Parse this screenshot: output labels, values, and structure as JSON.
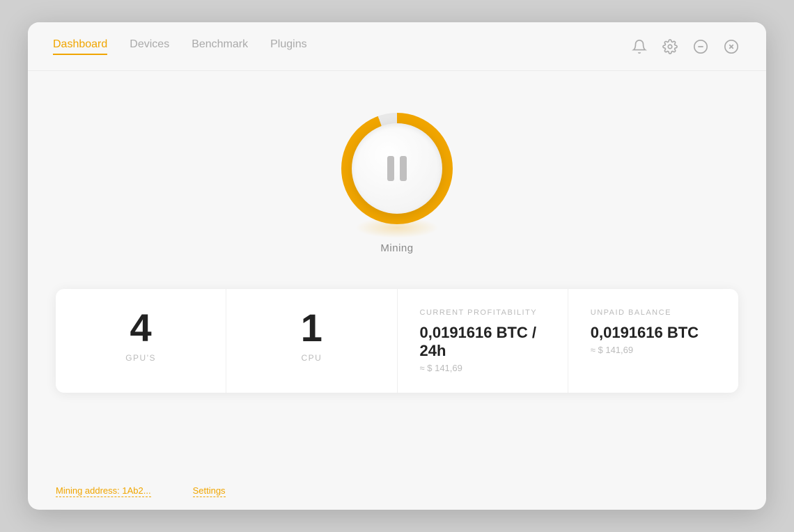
{
  "nav": {
    "items": [
      {
        "label": "Dashboard",
        "active": true
      },
      {
        "label": "Devices",
        "active": false
      },
      {
        "label": "Benchmark",
        "active": false
      },
      {
        "label": "Plugins",
        "active": false
      }
    ]
  },
  "header": {
    "icons": [
      {
        "name": "bell-icon",
        "symbol": "🔔"
      },
      {
        "name": "settings-icon",
        "symbol": "⚙"
      },
      {
        "name": "minimize-icon",
        "symbol": "⊖"
      },
      {
        "name": "close-icon",
        "symbol": "⊗"
      }
    ]
  },
  "mining": {
    "status_label": "Mining"
  },
  "stats": [
    {
      "id": "gpus",
      "number": "4",
      "sublabel": "GPU'S"
    },
    {
      "id": "cpu",
      "number": "1",
      "sublabel": "CPU"
    },
    {
      "id": "profitability",
      "label": "CURRENT PROFITABILITY",
      "value_main": "0,0191616 BTC / 24h",
      "value_sub": "≈ $ 141,69"
    },
    {
      "id": "balance",
      "label": "UNPAID BALANCE",
      "value_main": "0,0191616 BTC",
      "value_sub": "≈ $ 141,69"
    }
  ],
  "bottom_hints": [
    {
      "label": "Mining address: 1Ab2..."
    },
    {
      "label": "Settings"
    }
  ]
}
